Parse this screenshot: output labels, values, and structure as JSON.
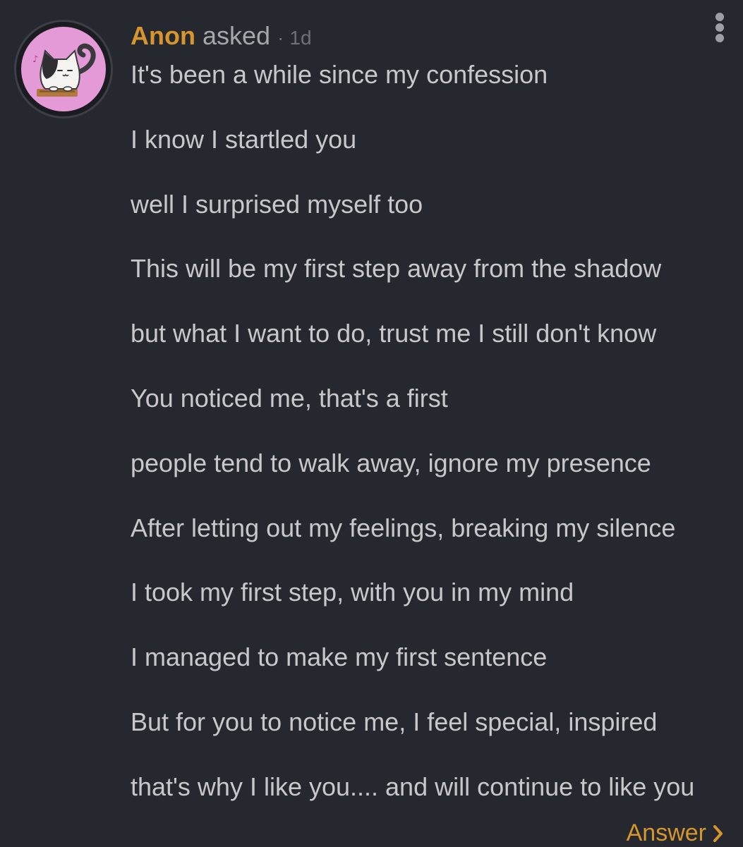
{
  "question": {
    "author": "Anon",
    "action": "asked",
    "separator": "·",
    "time": "1d",
    "lines": [
      "It's been a while since my confession",
      "I know I startled you",
      "well I surprised myself too",
      "This will be my first step away from the shadow",
      "but what I want to do, trust me I still don't know",
      "You noticed me, that's a first",
      "people tend to walk away, ignore my presence",
      "After letting out my feelings, breaking my silence",
      "I took my first step, with you in my mind",
      "I managed to make my first sentence",
      "But for you to notice me, I feel special, inspired",
      "that's why I like you.... and will continue to like you"
    ],
    "answer_label": "Answer"
  },
  "icons": {
    "avatar": "cat-avatar-icon",
    "menu": "more-vertical-icon",
    "answer_chevron": "chevron-right-icon"
  },
  "colors": {
    "background": "#262830",
    "author": "#d7962d",
    "text": "#c8c8ca",
    "muted": "#6f7077",
    "avatar_bg": "#e59ad8"
  }
}
